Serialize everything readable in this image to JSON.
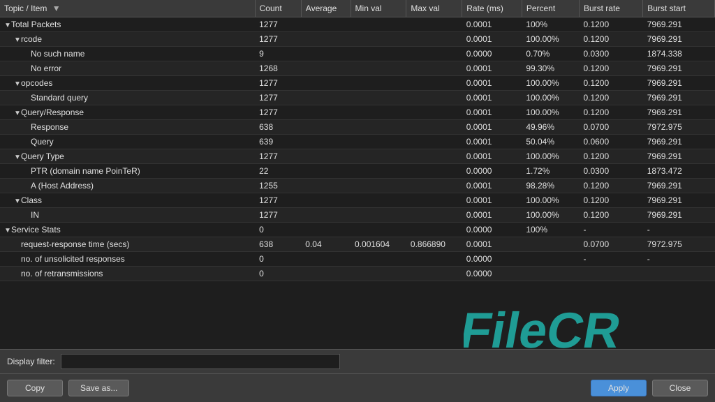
{
  "header": {
    "col_topic": "Topic / Item",
    "col_count": "Count",
    "col_average": "Average",
    "col_minval": "Min val",
    "col_maxval": "Max val",
    "col_rate": "Rate (ms)",
    "col_percent": "Percent",
    "col_burst": "Burst rate",
    "col_burststart": "Burst start"
  },
  "rows": [
    {
      "indent": 0,
      "has_triangle": true,
      "expanded": true,
      "label": "Total Packets",
      "count": "1277",
      "average": "",
      "minval": "",
      "maxval": "",
      "rate": "0.0001",
      "percent": "100%",
      "burst": "0.1200",
      "burststart": "7969.291"
    },
    {
      "indent": 1,
      "has_triangle": true,
      "expanded": true,
      "label": "rcode",
      "count": "1277",
      "average": "",
      "minval": "",
      "maxval": "",
      "rate": "0.0001",
      "percent": "100.00%",
      "burst": "0.1200",
      "burststart": "7969.291"
    },
    {
      "indent": 2,
      "has_triangle": false,
      "expanded": false,
      "label": "No such name",
      "count": "9",
      "average": "",
      "minval": "",
      "maxval": "",
      "rate": "0.0000",
      "percent": "0.70%",
      "burst": "0.0300",
      "burststart": "1874.338"
    },
    {
      "indent": 2,
      "has_triangle": false,
      "expanded": false,
      "label": "No error",
      "count": "1268",
      "average": "",
      "minval": "",
      "maxval": "",
      "rate": "0.0001",
      "percent": "99.30%",
      "burst": "0.1200",
      "burststart": "7969.291"
    },
    {
      "indent": 1,
      "has_triangle": true,
      "expanded": true,
      "label": "opcodes",
      "count": "1277",
      "average": "",
      "minval": "",
      "maxval": "",
      "rate": "0.0001",
      "percent": "100.00%",
      "burst": "0.1200",
      "burststart": "7969.291"
    },
    {
      "indent": 2,
      "has_triangle": false,
      "expanded": false,
      "label": "Standard query",
      "count": "1277",
      "average": "",
      "minval": "",
      "maxval": "",
      "rate": "0.0001",
      "percent": "100.00%",
      "burst": "0.1200",
      "burststart": "7969.291"
    },
    {
      "indent": 1,
      "has_triangle": true,
      "expanded": true,
      "label": "Query/Response",
      "count": "1277",
      "average": "",
      "minval": "",
      "maxval": "",
      "rate": "0.0001",
      "percent": "100.00%",
      "burst": "0.1200",
      "burststart": "7969.291"
    },
    {
      "indent": 2,
      "has_triangle": false,
      "expanded": false,
      "label": "Response",
      "count": "638",
      "average": "",
      "minval": "",
      "maxval": "",
      "rate": "0.0001",
      "percent": "49.96%",
      "burst": "0.0700",
      "burststart": "7972.975"
    },
    {
      "indent": 2,
      "has_triangle": false,
      "expanded": false,
      "label": "Query",
      "count": "639",
      "average": "",
      "minval": "",
      "maxval": "",
      "rate": "0.0001",
      "percent": "50.04%",
      "burst": "0.0600",
      "burststart": "7969.291"
    },
    {
      "indent": 1,
      "has_triangle": true,
      "expanded": true,
      "label": "Query Type",
      "count": "1277",
      "average": "",
      "minval": "",
      "maxval": "",
      "rate": "0.0001",
      "percent": "100.00%",
      "burst": "0.1200",
      "burststart": "7969.291"
    },
    {
      "indent": 2,
      "has_triangle": false,
      "expanded": false,
      "label": "PTR (domain name PoinTeR)",
      "count": "22",
      "average": "",
      "minval": "",
      "maxval": "",
      "rate": "0.0000",
      "percent": "1.72%",
      "burst": "0.0300",
      "burststart": "1873.472"
    },
    {
      "indent": 2,
      "has_triangle": false,
      "expanded": false,
      "label": "A (Host Address)",
      "count": "1255",
      "average": "",
      "minval": "",
      "maxval": "",
      "rate": "0.0001",
      "percent": "98.28%",
      "burst": "0.1200",
      "burststart": "7969.291"
    },
    {
      "indent": 1,
      "has_triangle": true,
      "expanded": true,
      "label": "Class",
      "count": "1277",
      "average": "",
      "minval": "",
      "maxval": "",
      "rate": "0.0001",
      "percent": "100.00%",
      "burst": "0.1200",
      "burststart": "7969.291"
    },
    {
      "indent": 2,
      "has_triangle": false,
      "expanded": false,
      "label": "IN",
      "count": "1277",
      "average": "",
      "minval": "",
      "maxval": "",
      "rate": "0.0001",
      "percent": "100.00%",
      "burst": "0.1200",
      "burststart": "7969.291"
    },
    {
      "indent": 0,
      "has_triangle": true,
      "expanded": true,
      "label": "Service Stats",
      "count": "0",
      "average": "",
      "minval": "",
      "maxval": "",
      "rate": "0.0000",
      "percent": "100%",
      "burst": "-",
      "burststart": "-"
    },
    {
      "indent": 1,
      "has_triangle": false,
      "expanded": false,
      "label": "request-response time (secs)",
      "count": "638",
      "average": "0.04",
      "minval": "0.001604",
      "maxval": "0.866890",
      "rate": "0.0001",
      "percent": "",
      "burst": "0.0700",
      "burststart": "7972.975"
    },
    {
      "indent": 1,
      "has_triangle": false,
      "expanded": false,
      "label": "no. of unsolicited responses",
      "count": "0",
      "average": "",
      "minval": "",
      "maxval": "",
      "rate": "0.0000",
      "percent": "",
      "burst": "-",
      "burststart": "-"
    },
    {
      "indent": 1,
      "has_triangle": false,
      "expanded": false,
      "label": "no. of retransmissions",
      "count": "0",
      "average": "",
      "minval": "",
      "maxval": "",
      "rate": "0.0000",
      "percent": "",
      "burst": "",
      "burststart": ""
    }
  ],
  "filter": {
    "label": "Display filter:",
    "placeholder": "",
    "value": ""
  },
  "buttons": {
    "copy": "Copy",
    "save_as": "Save as...",
    "apply": "Apply",
    "close": "Close"
  }
}
